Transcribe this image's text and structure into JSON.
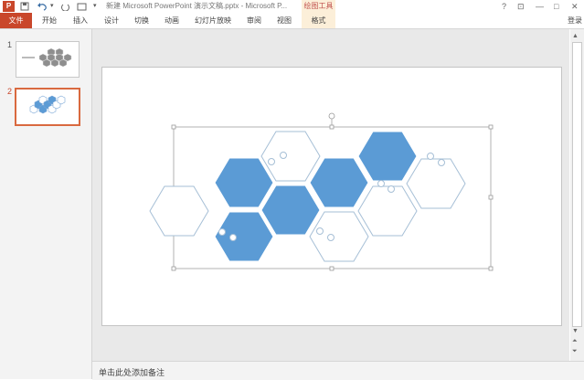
{
  "titlebar": {
    "app_icon_label": "P",
    "save_icon": "save-icon",
    "undo_icon": "undo-icon",
    "redo_icon": "redo-icon",
    "customize_icon": "customize-icon",
    "title": "新建 Microsoft PowerPoint 演示文稿.pptx - Microsoft P...",
    "contextual_group": "绘图工具",
    "help": "?",
    "ribbon_display": "⊡",
    "minimize": "—",
    "restore": "□",
    "close": "✕"
  },
  "ribbon": {
    "tabs": [
      {
        "label": "文件"
      },
      {
        "label": "开始"
      },
      {
        "label": "插入"
      },
      {
        "label": "设计"
      },
      {
        "label": "切换"
      },
      {
        "label": "动画"
      },
      {
        "label": "幻灯片放映"
      },
      {
        "label": "审阅"
      },
      {
        "label": "视图"
      },
      {
        "label": "格式"
      }
    ],
    "login": "登录"
  },
  "slide_pane": {
    "slides": [
      {
        "number": "1"
      },
      {
        "number": "2"
      }
    ]
  },
  "editor": {
    "shape_fill": "#5b9bd5",
    "outline_color": "#a6bfd6",
    "accent_color": "#c9472b"
  },
  "notes": {
    "placeholder": "单击此处添加备注"
  }
}
